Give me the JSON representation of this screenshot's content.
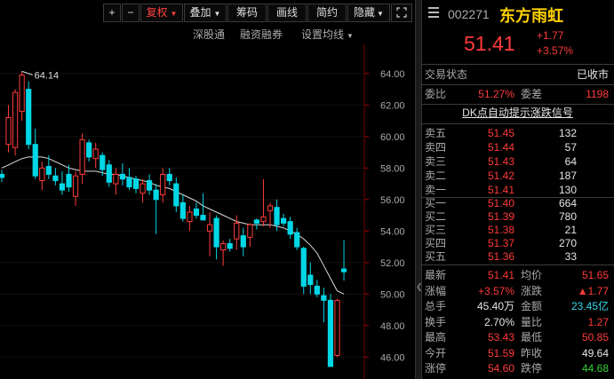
{
  "toolbar": {
    "plus": "+",
    "minus": "−",
    "fuquan": "复权",
    "diejia": "叠加",
    "chouma": "筹码",
    "huaxian": "画线",
    "jianyue": "简约",
    "yincang": "隐藏"
  },
  "subbar": {
    "shengang": "深股通",
    "rongzi": "融资融券",
    "junxian": "设置均线"
  },
  "chart": {
    "peak_label": "64.14",
    "y_ticks": [
      "64.00",
      "62.00",
      "60.00",
      "58.00",
      "56.00",
      "54.00",
      "52.00",
      "50.00",
      "48.00",
      "46.00"
    ]
  },
  "chart_data": {
    "type": "candlestick",
    "ylim": [
      45.0,
      65.4
    ],
    "colors": {
      "up": "#ff3a3a",
      "down": "#00d7e6",
      "ma": "#dddddd"
    },
    "candles": [
      {
        "o": 57.6,
        "h": 57.9,
        "l": 57.1,
        "c": 57.4
      },
      {
        "o": 59.5,
        "h": 62.0,
        "l": 59.0,
        "c": 61.2
      },
      {
        "o": 59.3,
        "h": 63.0,
        "l": 58.8,
        "c": 62.8
      },
      {
        "o": 61.6,
        "h": 64.14,
        "l": 61.0,
        "c": 63.9
      },
      {
        "o": 63.0,
        "h": 63.5,
        "l": 59.2,
        "c": 59.5
      },
      {
        "o": 59.5,
        "h": 60.5,
        "l": 57.3,
        "c": 57.5
      },
      {
        "o": 57.2,
        "h": 58.4,
        "l": 56.6,
        "c": 58.0
      },
      {
        "o": 58.1,
        "h": 58.8,
        "l": 57.3,
        "c": 57.6
      },
      {
        "o": 57.5,
        "h": 58.0,
        "l": 56.9,
        "c": 57.2
      },
      {
        "o": 57.0,
        "h": 57.8,
        "l": 56.3,
        "c": 56.6
      },
      {
        "o": 57.6,
        "h": 58.2,
        "l": 56.5,
        "c": 56.8
      },
      {
        "o": 56.2,
        "h": 57.8,
        "l": 55.6,
        "c": 57.5
      },
      {
        "o": 57.6,
        "h": 60.2,
        "l": 57.0,
        "c": 59.8
      },
      {
        "o": 59.6,
        "h": 59.8,
        "l": 58.4,
        "c": 58.7
      },
      {
        "o": 58.6,
        "h": 59.6,
        "l": 58.0,
        "c": 59.2
      },
      {
        "o": 58.8,
        "h": 59.0,
        "l": 57.5,
        "c": 57.9
      },
      {
        "o": 58.2,
        "h": 58.5,
        "l": 56.8,
        "c": 57.1
      },
      {
        "o": 57.0,
        "h": 58.0,
        "l": 56.3,
        "c": 57.6
      },
      {
        "o": 57.6,
        "h": 58.3,
        "l": 56.9,
        "c": 57.3
      },
      {
        "o": 57.4,
        "h": 58.0,
        "l": 56.6,
        "c": 56.8
      },
      {
        "o": 57.3,
        "h": 57.5,
        "l": 56.4,
        "c": 56.7
      },
      {
        "o": 56.4,
        "h": 57.3,
        "l": 55.8,
        "c": 57.0
      },
      {
        "o": 57.2,
        "h": 57.6,
        "l": 56.3,
        "c": 56.6
      },
      {
        "o": 56.6,
        "h": 57.0,
        "l": 53.8,
        "c": 56.0
      },
      {
        "o": 56.3,
        "h": 58.0,
        "l": 55.8,
        "c": 57.6
      },
      {
        "o": 57.6,
        "h": 58.0,
        "l": 56.9,
        "c": 57.2
      },
      {
        "o": 57.0,
        "h": 57.4,
        "l": 55.2,
        "c": 55.6
      },
      {
        "o": 55.8,
        "h": 56.3,
        "l": 54.6,
        "c": 54.8
      },
      {
        "o": 54.6,
        "h": 55.6,
        "l": 54.0,
        "c": 55.2
      },
      {
        "o": 55.4,
        "h": 55.8,
        "l": 54.8,
        "c": 55.0
      },
      {
        "o": 55.0,
        "h": 56.4,
        "l": 54.8,
        "c": 54.7
      },
      {
        "o": 54.0,
        "h": 55.2,
        "l": 52.4,
        "c": 54.4
      },
      {
        "o": 54.8,
        "h": 55.0,
        "l": 52.2,
        "c": 53.0
      },
      {
        "o": 52.8,
        "h": 53.4,
        "l": 51.8,
        "c": 53.2
      },
      {
        "o": 53.2,
        "h": 53.5,
        "l": 52.7,
        "c": 52.9
      },
      {
        "o": 53.5,
        "h": 55.0,
        "l": 52.8,
        "c": 54.5
      },
      {
        "o": 53.7,
        "h": 54.2,
        "l": 52.4,
        "c": 53.0
      },
      {
        "o": 53.6,
        "h": 54.5,
        "l": 53.0,
        "c": 54.4
      },
      {
        "o": 54.7,
        "h": 54.8,
        "l": 54.1,
        "c": 54.5
      },
      {
        "o": 54.6,
        "h": 57.3,
        "l": 54.3,
        "c": 54.9
      },
      {
        "o": 55.3,
        "h": 55.8,
        "l": 54.2,
        "c": 55.6
      },
      {
        "o": 55.5,
        "h": 56.0,
        "l": 54.0,
        "c": 54.4
      },
      {
        "o": 54.8,
        "h": 55.1,
        "l": 54.3,
        "c": 54.5
      },
      {
        "o": 54.6,
        "h": 54.9,
        "l": 53.5,
        "c": 53.8
      },
      {
        "o": 53.9,
        "h": 54.2,
        "l": 52.8,
        "c": 53.0
      },
      {
        "o": 52.9,
        "h": 53.0,
        "l": 50.0,
        "c": 50.5
      },
      {
        "o": 51.2,
        "h": 52.0,
        "l": 50.0,
        "c": 50.6
      },
      {
        "o": 50.5,
        "h": 50.9,
        "l": 49.8,
        "c": 50.0
      },
      {
        "o": 49.9,
        "h": 50.4,
        "l": 48.2,
        "c": 49.6
      },
      {
        "o": 49.6,
        "h": 50.0,
        "l": 45.5,
        "c": 45.4
      },
      {
        "o": 46.1,
        "h": 49.7,
        "l": 46.0,
        "c": 49.6
      },
      {
        "o": 51.59,
        "h": 53.43,
        "l": 50.85,
        "c": 51.41
      }
    ],
    "ma": [
      58.0,
      58.2,
      58.4,
      58.6,
      58.7,
      58.7,
      58.7,
      58.6,
      58.4,
      58.2,
      58.0,
      57.9,
      57.8,
      57.8,
      57.8,
      57.7,
      57.6,
      57.6,
      57.5,
      57.4,
      57.3,
      57.2,
      57.1,
      56.9,
      56.8,
      56.7,
      56.5,
      56.3,
      56.1,
      55.9,
      55.6,
      55.4,
      55.2,
      55.0,
      54.8,
      54.6,
      54.5,
      54.4,
      54.4,
      54.4,
      54.4,
      54.3,
      54.2,
      54.0,
      53.8,
      53.5,
      53.1,
      52.6,
      51.8,
      51.0,
      50.2,
      50.0
    ]
  },
  "quote": {
    "code": "002271",
    "name": "东方雨虹",
    "price": "51.41",
    "change": "+1.77",
    "change_pct": "+3.57%",
    "status_label": "交易状态",
    "status_value": "已收市",
    "weibi_label": "委比",
    "weibi_value": "51.27%",
    "weicha_label": "委差",
    "weicha_value": "1198",
    "dk_link": "DK点自动提示涨跌信号",
    "asks": [
      {
        "label": "卖五",
        "price": "51.45",
        "vol": "132"
      },
      {
        "label": "卖四",
        "price": "51.44",
        "vol": "57"
      },
      {
        "label": "卖三",
        "price": "51.43",
        "vol": "64"
      },
      {
        "label": "卖二",
        "price": "51.42",
        "vol": "187"
      },
      {
        "label": "卖一",
        "price": "51.41",
        "vol": "130"
      }
    ],
    "bids": [
      {
        "label": "买一",
        "price": "51.40",
        "vol": "664"
      },
      {
        "label": "买二",
        "price": "51.39",
        "vol": "780"
      },
      {
        "label": "买三",
        "price": "51.38",
        "vol": "21"
      },
      {
        "label": "买四",
        "price": "51.37",
        "vol": "270"
      },
      {
        "label": "买五",
        "price": "51.36",
        "vol": "33"
      }
    ],
    "stats": [
      {
        "l1": "最新",
        "v1": "51.41",
        "c1": "red",
        "l2": "均价",
        "v2": "51.65",
        "c2": "red"
      },
      {
        "l1": "涨幅",
        "v1": "+3.57%",
        "c1": "red",
        "l2": "涨跌",
        "v2": "▲1.77",
        "c2": "red"
      },
      {
        "l1": "总手",
        "v1": "45.40万",
        "c1": "white",
        "l2": "金额",
        "v2": "23.45亿",
        "c2": "cyan"
      },
      {
        "l1": "换手",
        "v1": "2.70%",
        "c1": "white",
        "l2": "量比",
        "v2": "1.27",
        "c2": "red"
      },
      {
        "l1": "最高",
        "v1": "53.43",
        "c1": "red",
        "l2": "最低",
        "v2": "50.85",
        "c2": "red"
      },
      {
        "l1": "今开",
        "v1": "51.59",
        "c1": "red",
        "l2": "昨收",
        "v2": "49.64",
        "c2": "white"
      },
      {
        "l1": "涨停",
        "v1": "54.60",
        "c1": "red",
        "l2": "跌停",
        "v2": "44.68",
        "c2": "green"
      }
    ]
  }
}
